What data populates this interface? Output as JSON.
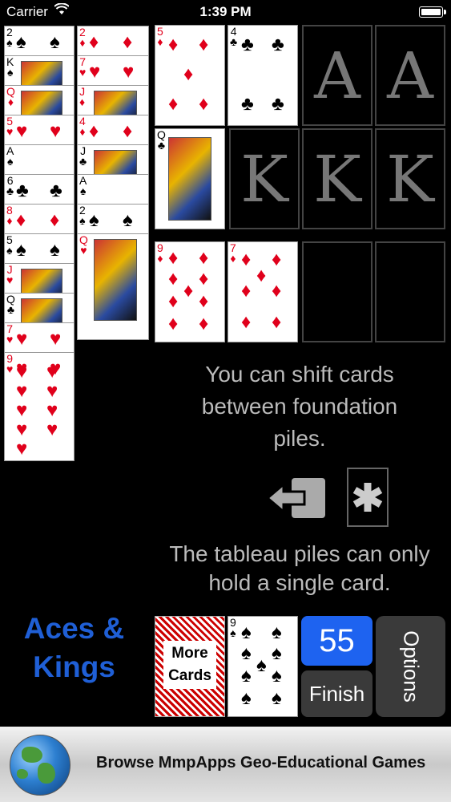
{
  "status": {
    "carrier": "Carrier",
    "time": "1:39 PM"
  },
  "col1": [
    {
      "rank": "2",
      "suit": "♠",
      "color": "blk"
    },
    {
      "rank": "K",
      "suit": "♠",
      "color": "blk"
    },
    {
      "rank": "Q",
      "suit": "♦",
      "color": "red"
    },
    {
      "rank": "5",
      "suit": "♥",
      "color": "red"
    },
    {
      "rank": "A",
      "suit": "♠",
      "color": "blk"
    },
    {
      "rank": "6",
      "suit": "♣",
      "color": "blk"
    },
    {
      "rank": "8",
      "suit": "♦",
      "color": "red"
    },
    {
      "rank": "5",
      "suit": "♠",
      "color": "blk"
    },
    {
      "rank": "J",
      "suit": "♥",
      "color": "red"
    },
    {
      "rank": "Q",
      "suit": "♣",
      "color": "blk"
    },
    {
      "rank": "7",
      "suit": "♥",
      "color": "red"
    },
    {
      "rank": "9",
      "suit": "♥",
      "color": "red"
    }
  ],
  "col2": [
    {
      "rank": "2",
      "suit": "♦",
      "color": "red"
    },
    {
      "rank": "7",
      "suit": "♥",
      "color": "red"
    },
    {
      "rank": "J",
      "suit": "♦",
      "color": "red"
    },
    {
      "rank": "4",
      "suit": "♦",
      "color": "red"
    },
    {
      "rank": "J",
      "suit": "♣",
      "color": "blk"
    },
    {
      "rank": "A",
      "suit": "♠",
      "color": "blk"
    },
    {
      "rank": "2",
      "suit": "♠",
      "color": "blk"
    },
    {
      "rank": "Q",
      "suit": "♥",
      "color": "red"
    }
  ],
  "foundation": {
    "aces": [
      "A",
      "A"
    ],
    "kings": [
      "K",
      "K",
      "K"
    ]
  },
  "tableau": [
    {
      "rank": "5",
      "suit": "♦",
      "color": "red"
    },
    {
      "rank": "4",
      "suit": "♣",
      "color": "blk"
    },
    {
      "rank": "Q",
      "suit": "♣",
      "color": "blk"
    },
    {
      "rank": "9",
      "suit": "♦",
      "color": "red"
    },
    {
      "rank": "7",
      "suit": "♦",
      "color": "red"
    }
  ],
  "hints": {
    "line1": "You can shift cards",
    "line2": "between foundation",
    "line3": "piles.",
    "line4": "The tableau piles can only",
    "line5": "hold a single card."
  },
  "title": {
    "line1": "Aces &",
    "line2": "Kings"
  },
  "controls": {
    "more1": "More",
    "more2": "Cards",
    "counter": "55",
    "finish": "Finish",
    "options": "Options"
  },
  "waste": {
    "rank": "9",
    "suit": "♠",
    "color": "blk"
  },
  "banner": {
    "text": "Browse MmpApps Geo-Educational Games"
  },
  "colors": {
    "accent": "#1e63f0",
    "title": "#1f5fd6"
  }
}
